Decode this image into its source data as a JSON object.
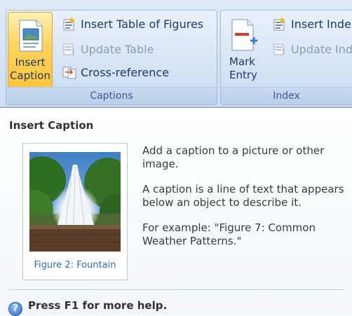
{
  "ribbon": {
    "captions_group": {
      "label": "Captions",
      "insert_caption_line1": "Insert",
      "insert_caption_line2": "Caption",
      "insert_table_of_figures": "Insert Table of Figures",
      "update_table": "Update Table",
      "cross_reference": "Cross-reference"
    },
    "index_group": {
      "label": "Index",
      "mark_entry_line1": "Mark",
      "mark_entry_line2": "Entry",
      "insert_index": "Insert Inde",
      "update_index": "Update Ind"
    }
  },
  "tooltip": {
    "title": "Insert Caption",
    "description_1": "Add a caption to a picture or other image.",
    "description_2": "A caption is a line of text that appears below an object to describe it.",
    "description_3": "For example: \"Figure 7: Common Weather Patterns.\"",
    "figure_caption": "Figure 2: Fountain",
    "help_icon": "?",
    "help_text": "Press F1 for more help."
  },
  "colors": {
    "active_button": "#ffd35c",
    "ribbon_text": "#1e3a66",
    "caption_link": "#2f6db5"
  }
}
